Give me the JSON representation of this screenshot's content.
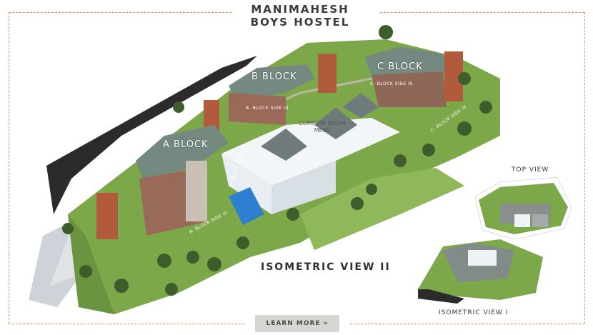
{
  "title": {
    "line1": "MANIMAHESH",
    "line2": "BOYS HOSTEL"
  },
  "blocks": {
    "a": "A BLOCK",
    "b": "B BLOCK",
    "c": "C BLOCK",
    "common_room_line1": "COMMON ROOM",
    "common_room_line2": "MESS"
  },
  "side_labels": {
    "a_side_iii": "A- BLOCK SIDE III",
    "a_side_iv": "A- BLOCK SIDE IV",
    "b_side_iii": "B- BLOCK SIDE III",
    "c_side_iii": "C- BLOCK SIDE III",
    "c_side_iv": "C- BLOCK SIDE IV"
  },
  "views": {
    "main": "ISOMETRIC VIEW II",
    "top": "TOP VIEW",
    "iso1": "ISOMETRIC VIEW I"
  },
  "learn_more": "LEARN MORE »",
  "colors": {
    "frame": "#e98a5c",
    "grass": "#7da84a",
    "roof": "#748a80",
    "brick": "#b15a3c"
  }
}
